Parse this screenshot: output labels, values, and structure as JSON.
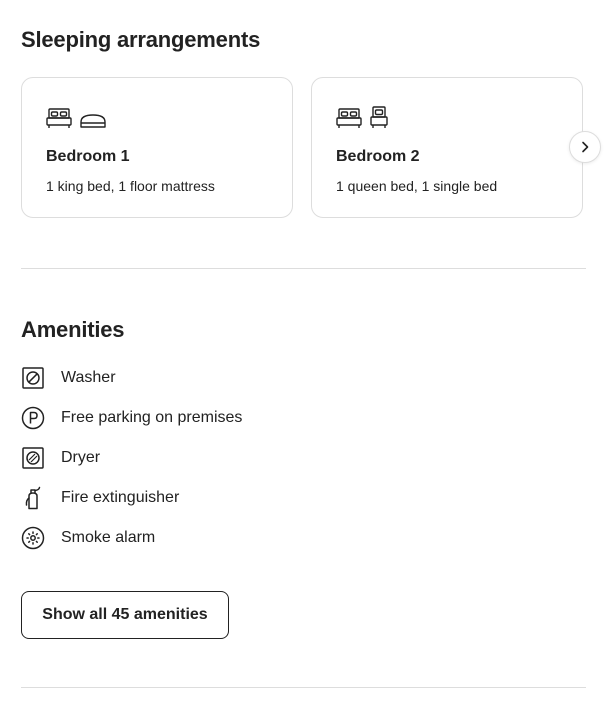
{
  "sleeping": {
    "title": "Sleeping arrangements",
    "rooms": [
      {
        "name": "Bedroom 1",
        "beds": "1 king bed, 1 floor mattress",
        "icons": [
          "king-bed-icon",
          "floor-mattress-icon"
        ]
      },
      {
        "name": "Bedroom 2",
        "beds": "1 queen bed, 1 single bed",
        "icons": [
          "queen-bed-icon",
          "single-bed-icon"
        ]
      }
    ],
    "next_icon": "chevron-right-icon"
  },
  "amenities": {
    "title": "Amenities",
    "items": [
      {
        "label": "Washer",
        "icon": "washer-icon"
      },
      {
        "label": "Free parking on premises",
        "icon": "parking-icon"
      },
      {
        "label": "Dryer",
        "icon": "dryer-icon"
      },
      {
        "label": "Fire extinguisher",
        "icon": "fire-extinguisher-icon"
      },
      {
        "label": "Smoke alarm",
        "icon": "smoke-alarm-icon"
      }
    ],
    "show_all_label": "Show all 45 amenities"
  }
}
